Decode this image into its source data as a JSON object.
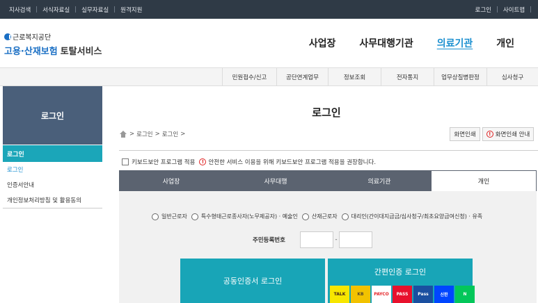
{
  "topbar": {
    "left_links": [
      "지사검색",
      "서식자료실",
      "실무자료실",
      "원격지원"
    ],
    "right_links": [
      "로그인",
      "사이트맵"
    ]
  },
  "logo": {
    "org": "근로복지공단",
    "service_blue": "고용·산재보험",
    "service_dark": "토탈서비스"
  },
  "main_nav": [
    {
      "label": "사업장",
      "active": false
    },
    {
      "label": "사무대행기관",
      "active": false
    },
    {
      "label": "의료기관",
      "active": true
    },
    {
      "label": "개인",
      "active": false
    }
  ],
  "sub_nav": [
    "민원접수/신고",
    "공단연계업무",
    "정보조회",
    "전자통지",
    "업무상질병판정",
    "심사청구"
  ],
  "sidebar": {
    "title": "로그인",
    "section": "로그인",
    "items": [
      {
        "label": "로그인",
        "active": true
      },
      {
        "label": "인증서안내",
        "active": false
      },
      {
        "label": "개인정보처리방침 및 활용동의",
        "active": false
      }
    ]
  },
  "content": {
    "title": "로그인",
    "breadcrumb": [
      "로그인",
      "로그인"
    ],
    "print_button": "화면인쇄",
    "print_guide_button": "화면인쇄 안내",
    "keyboard_security_label": "키보드보안 프로그램 적용",
    "keyboard_security_notice": "안전한 서비스 이용을 위해 키보드보안 프로그램 적용을 권장합니다.",
    "user_tabs": [
      {
        "label": "사업장",
        "active": false
      },
      {
        "label": "사무대행",
        "active": false
      },
      {
        "label": "의료기관",
        "active": false
      },
      {
        "label": "개인",
        "active": true
      }
    ],
    "user_types": [
      "일반근로자",
      "특수형태근로종사자(노무제공자) · 예술인",
      "산재근로자",
      "대리인(간이대지급금/심사청구/최초요양급여신청) · 유족"
    ],
    "jumin_label": "주민등록번호",
    "jumin_dash": "-",
    "cert_login": "공동인증서 로그인",
    "simple_login": "간편인증 로그인",
    "providers": [
      {
        "name": "TALK",
        "bg": "#f7e600",
        "fg": "#3c1e1e"
      },
      {
        "name": "KB",
        "bg": "#f2c200",
        "fg": "#5a4a2a"
      },
      {
        "name": "PAYCO",
        "bg": "#ffffff",
        "fg": "#e52528"
      },
      {
        "name": "PASS",
        "bg": "#e8112d",
        "fg": "#ffffff"
      },
      {
        "name": "Pass",
        "bg": "#1a4fa0",
        "fg": "#ffffff"
      },
      {
        "name": "신한",
        "bg": "#0046ff",
        "fg": "#ffffff"
      },
      {
        "name": "N",
        "bg": "#03c75a",
        "fg": "#ffffff"
      }
    ]
  },
  "colors": {
    "topbar": "#2f3a46",
    "accent_teal": "#18a5b7",
    "sidebar_title": "#4a5f7a",
    "tab_dark": "#5b6370",
    "link_blue": "#1a8fd0"
  }
}
